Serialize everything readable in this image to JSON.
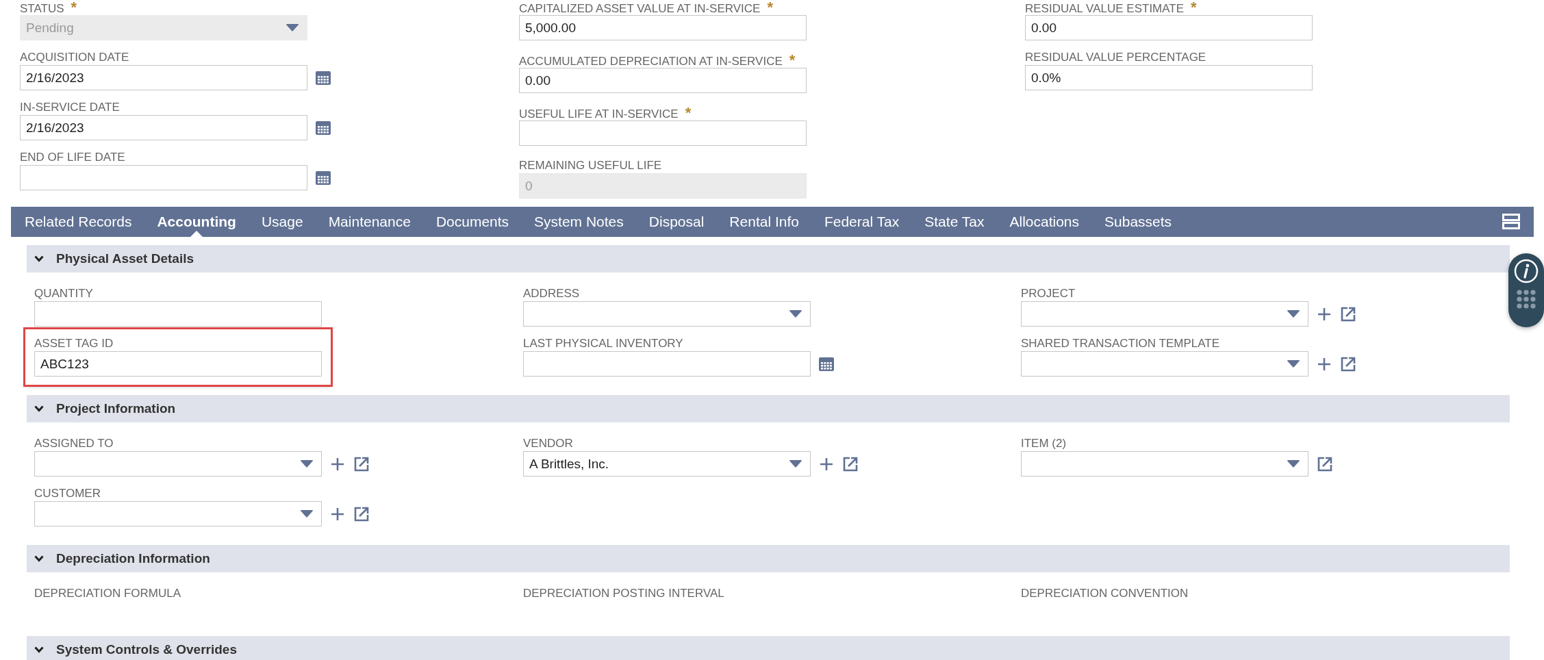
{
  "header_columns": [
    [
      {
        "label": "STATUS",
        "required_mark": "*",
        "kind": "select",
        "value": "Pending",
        "disabled": true,
        "highlighted": false
      },
      {
        "label": "ACQUISITION DATE",
        "kind": "date",
        "value": "2/16/2023",
        "disabled": false,
        "highlighted": false
      },
      {
        "label": "IN-SERVICE DATE",
        "kind": "date",
        "value": "2/16/2023",
        "disabled": false,
        "highlighted": false
      },
      {
        "label": "END OF LIFE DATE",
        "kind": "date",
        "disabled": false,
        "highlighted": false
      }
    ],
    [
      {
        "label": "CAPITALIZED ASSET VALUE AT IN-SERVICE",
        "required_mark": "*",
        "kind": "text",
        "value": "5,000.00",
        "disabled": false,
        "highlighted": false
      },
      {
        "label": "ACCUMULATED DEPRECIATION AT IN-SERVICE",
        "required_mark": "*",
        "kind": "text",
        "value": "0.00",
        "disabled": false,
        "highlighted": false
      },
      {
        "label": "USEFUL LIFE AT IN-SERVICE",
        "required_mark": "*",
        "kind": "text",
        "disabled": false,
        "highlighted": false
      },
      {
        "label": "REMAINING USEFUL LIFE",
        "kind": "text",
        "value": "0",
        "disabled": true,
        "highlighted": false
      }
    ],
    [
      {
        "label": "RESIDUAL VALUE ESTIMATE",
        "required_mark": "*",
        "kind": "text",
        "value": "0.00",
        "disabled": false,
        "highlighted": false
      },
      {
        "label": "RESIDUAL VALUE PERCENTAGE",
        "kind": "text",
        "value": "0.0%",
        "disabled": false,
        "highlighted": false
      }
    ]
  ],
  "tabs": [
    {
      "label": "Related Records",
      "selected": false
    },
    {
      "label": "Accounting",
      "selected": true
    },
    {
      "label": "Usage",
      "selected": false
    },
    {
      "label": "Maintenance",
      "selected": false
    },
    {
      "label": "Documents",
      "selected": false
    },
    {
      "label": "System Notes",
      "selected": false
    },
    {
      "label": "Disposal",
      "selected": false
    },
    {
      "label": "Rental Info",
      "selected": false
    },
    {
      "label": "Federal Tax",
      "selected": false
    },
    {
      "label": "State Tax",
      "selected": false
    },
    {
      "label": "Allocations",
      "selected": false
    },
    {
      "label": "Subassets",
      "selected": false
    }
  ],
  "sections": [
    {
      "title": "Physical Asset Details",
      "expanded": true,
      "columns": [
        [
          {
            "label": "QUANTITY",
            "kind": "text",
            "disabled": false,
            "highlighted": false
          },
          {
            "label": "ASSET TAG ID",
            "kind": "text",
            "value": "ABC123",
            "disabled": false,
            "highlighted": true
          }
        ],
        [
          {
            "label": "ADDRESS",
            "kind": "select",
            "disabled": false,
            "highlighted": false
          },
          {
            "label": "LAST PHYSICAL INVENTORY",
            "kind": "date",
            "disabled": false,
            "highlighted": false
          }
        ],
        [
          {
            "label": "PROJECT",
            "kind": "select",
            "add": true,
            "open": true,
            "disabled": false,
            "highlighted": false
          },
          {
            "label": "SHARED TRANSACTION TEMPLATE",
            "kind": "select",
            "add": true,
            "open": true,
            "disabled": false,
            "highlighted": false
          }
        ]
      ]
    },
    {
      "title": "Project Information",
      "expanded": true,
      "columns": [
        [
          {
            "label": "ASSIGNED TO",
            "kind": "select",
            "add": true,
            "open": true,
            "disabled": false,
            "highlighted": false
          },
          {
            "label": "CUSTOMER",
            "kind": "select",
            "add": true,
            "open": true,
            "disabled": false,
            "highlighted": false
          }
        ],
        [
          {
            "label": "VENDOR",
            "kind": "select",
            "value": "A Brittles, Inc.",
            "add": true,
            "open": true,
            "disabled": false,
            "highlighted": false
          }
        ],
        [
          {
            "label": "ITEM (2)",
            "kind": "select",
            "add": false,
            "open": true,
            "disabled": false,
            "highlighted": false
          }
        ]
      ]
    },
    {
      "title": "Depreciation Information",
      "expanded": true,
      "columns": [
        [
          {
            "label": "DEPRECIATION FORMULA",
            "kind": "label_only",
            "highlighted": false
          }
        ],
        [
          {
            "label": "DEPRECIATION POSTING INTERVAL",
            "kind": "label_only",
            "highlighted": false
          }
        ],
        [
          {
            "label": "DEPRECIATION CONVENTION",
            "kind": "label_only",
            "highlighted": false
          }
        ]
      ]
    },
    {
      "title": "System Controls & Overrides",
      "expanded": true
    }
  ]
}
